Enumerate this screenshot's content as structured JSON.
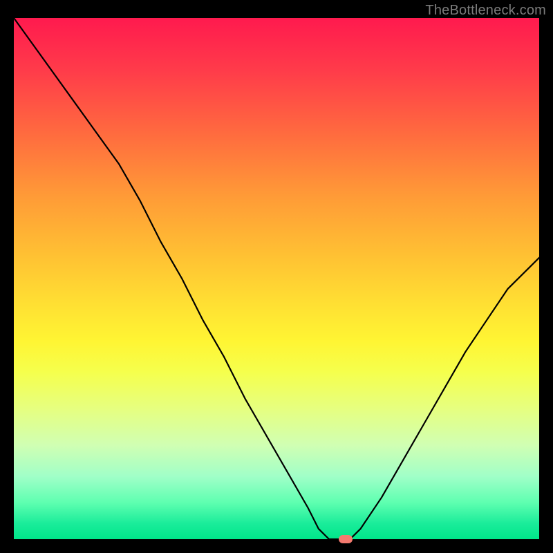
{
  "watermark": "TheBottleneck.com",
  "chart_data": {
    "type": "line",
    "title": "",
    "xlabel": "",
    "ylabel": "",
    "x": [
      0.0,
      0.05,
      0.1,
      0.15,
      0.2,
      0.24,
      0.28,
      0.32,
      0.36,
      0.4,
      0.44,
      0.48,
      0.52,
      0.56,
      0.58,
      0.6,
      0.62,
      0.64,
      0.66,
      0.7,
      0.74,
      0.78,
      0.82,
      0.86,
      0.9,
      0.94,
      0.98,
      1.0
    ],
    "values": [
      1.0,
      0.93,
      0.86,
      0.79,
      0.72,
      0.65,
      0.57,
      0.5,
      0.42,
      0.35,
      0.27,
      0.2,
      0.13,
      0.06,
      0.02,
      0.0,
      0.0,
      0.0,
      0.02,
      0.08,
      0.15,
      0.22,
      0.29,
      0.36,
      0.42,
      0.48,
      0.52,
      0.54
    ],
    "xlim": [
      0,
      1
    ],
    "ylim": [
      0,
      1
    ],
    "grid": false,
    "legend": false,
    "annotations": [],
    "marker_point": {
      "x": 0.632,
      "y": 0.0
    },
    "gradient_colors_top_to_bottom": [
      "#ff1a4e",
      "#ff6a3f",
      "#ffbf33",
      "#fff533",
      "#d0ffb3",
      "#00e68a"
    ]
  },
  "marker": {
    "color": "#f47a6f"
  }
}
